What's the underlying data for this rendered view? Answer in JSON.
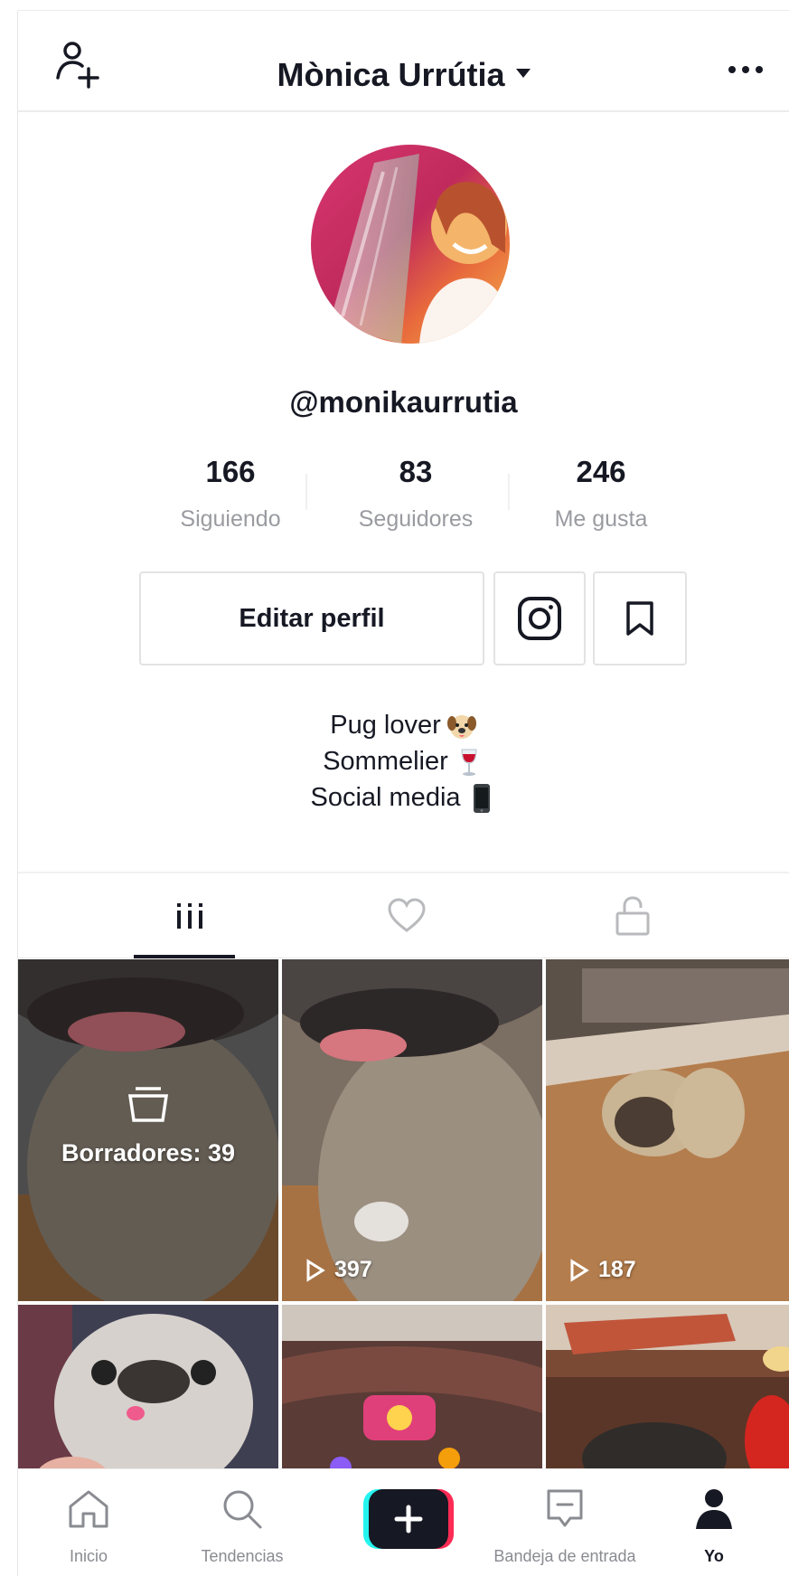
{
  "header": {
    "username": "Mònica Urrútia"
  },
  "profile": {
    "handle": "@monikaurrutia",
    "stats": [
      {
        "value": "166",
        "label": "Siguiendo"
      },
      {
        "value": "83",
        "label": "Seguidores"
      },
      {
        "value": "246",
        "label": "Me gusta"
      }
    ],
    "edit_label": "Editar perfil",
    "bio": [
      "Pug lover",
      "Sommelier",
      "Social media"
    ]
  },
  "videos": {
    "drafts_label": "Borradores: 39",
    "play_counts": [
      "397",
      "187"
    ]
  },
  "nav": {
    "items": [
      "Inicio",
      "Tendencias",
      "Bandeja de entrada",
      "Yo"
    ]
  },
  "colors": {
    "accent_cyan": "#25f4ee",
    "accent_pink": "#fe2c55",
    "text": "#161823",
    "muted": "#9a9ba1"
  }
}
